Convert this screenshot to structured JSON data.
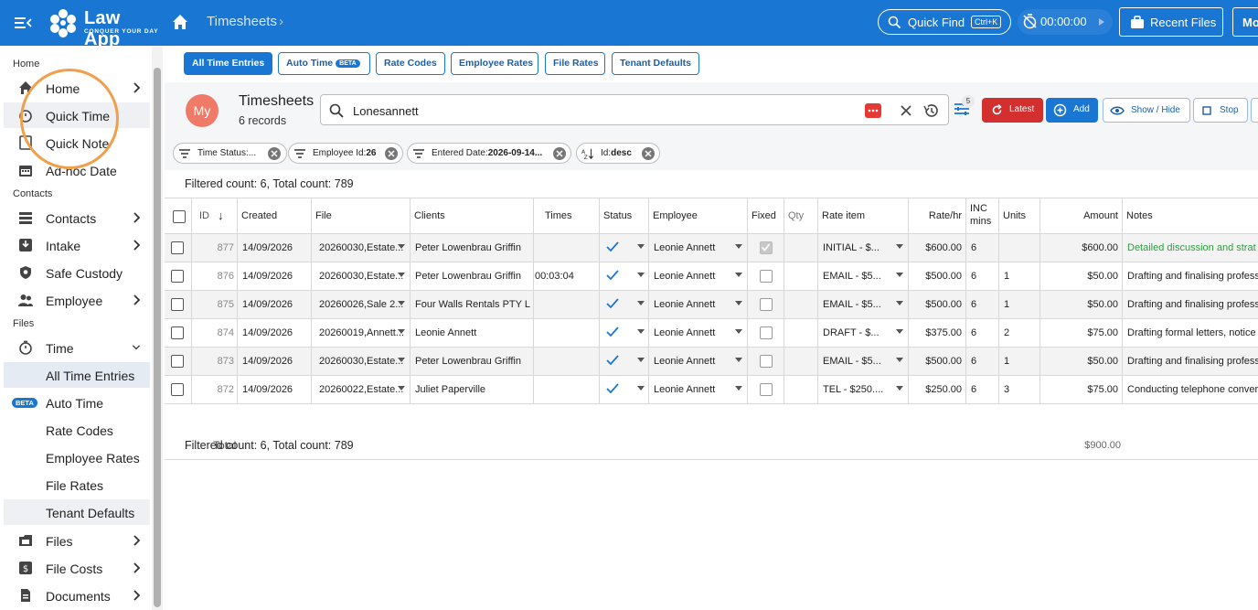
{
  "topbar": {
    "app_name": "Law App",
    "tagline": "CONQUER YOUR DAY",
    "breadcrumb": "Timesheets",
    "quick_find": "Quick Find",
    "quick_find_shortcut": "Ctrl+K",
    "timer": "00:00:00",
    "recent_files": "Recent Files",
    "more_label": "Mo"
  },
  "sidebar": {
    "sections": {
      "home": "Home",
      "contacts": "Contacts",
      "files": "Files"
    },
    "items": [
      {
        "label": "Home"
      },
      {
        "label": "Quick Time"
      },
      {
        "label": "Quick Note"
      },
      {
        "label": "Ad-hoc Date"
      },
      {
        "label": "Contacts"
      },
      {
        "label": "Intake"
      },
      {
        "label": "Safe Custody"
      },
      {
        "label": "Employee"
      },
      {
        "label": "Time"
      },
      {
        "label": "All Time Entries"
      },
      {
        "label": "Auto Time",
        "badge": "BETA"
      },
      {
        "label": "Rate Codes"
      },
      {
        "label": "Employee Rates"
      },
      {
        "label": "File Rates"
      },
      {
        "label": "Tenant Defaults"
      },
      {
        "label": "Files"
      },
      {
        "label": "File Costs"
      },
      {
        "label": "Documents"
      }
    ]
  },
  "tabs": [
    {
      "label": "All Time Entries"
    },
    {
      "label": "Auto Time",
      "badge": "BETA"
    },
    {
      "label": "Rate Codes"
    },
    {
      "label": "Employee Rates"
    },
    {
      "label": "File Rates"
    },
    {
      "label": "Tenant Defaults"
    }
  ],
  "header": {
    "avatar": "My",
    "title": "Timesheets",
    "records": "6 records",
    "search_value": "Lonesannett",
    "filter_count": "5",
    "latest": "Latest",
    "add": "Add",
    "show_hide": "Show / Hide",
    "stop": "Stop"
  },
  "chips": [
    {
      "label": "Time Status:..."
    },
    {
      "label": "Employee Id:",
      "value": "26"
    },
    {
      "label": "Entered Date:",
      "value": "2026-09-14..."
    },
    {
      "label": "Id:",
      "value": "desc"
    }
  ],
  "filtered_count": "Filtered count: 6, Total count: 789",
  "columns": [
    "ID",
    "Created",
    "File",
    "Clients",
    "Times",
    "Status",
    "Employee",
    "Fixed",
    "Qty",
    "Rate item",
    "Rate/hr",
    "INC mins",
    "Units",
    "Amount",
    "Notes"
  ],
  "rows": [
    {
      "id": "877",
      "created": "14/09/2026",
      "file": "20260030,Estate...",
      "client": "Peter Lowenbrau Griffin",
      "times": "",
      "employee": "Leonie Annett",
      "fixed": true,
      "rate_item": "INITIAL - $...",
      "rate": "$600.00",
      "inc": "6",
      "units": "",
      "amount": "$600.00",
      "notes": "Detailed discussion and strat",
      "notes_green": true
    },
    {
      "id": "876",
      "created": "14/09/2026",
      "file": "20260030,Estate...",
      "client": "Peter Lowenbrau Griffin",
      "times": "00:03:04",
      "employee": "Leonie Annett",
      "fixed": false,
      "rate_item": "EMAIL - $5...",
      "rate": "$500.00",
      "inc": "6",
      "units": "1",
      "amount": "$50.00",
      "notes": "Drafting and finalising profess",
      "notes_green": false
    },
    {
      "id": "875",
      "created": "14/09/2026",
      "file": "20260026,Sale 2...",
      "client": "Four Walls Rentals PTY L",
      "times": "",
      "employee": "Leonie Annett",
      "fixed": false,
      "rate_item": "EMAIL - $5...",
      "rate": "$500.00",
      "inc": "6",
      "units": "1",
      "amount": "$50.00",
      "notes": "Drafting and finalising profess",
      "notes_green": false
    },
    {
      "id": "874",
      "created": "14/09/2026",
      "file": "20260019,Annett...",
      "client": "Leonie Annett",
      "times": "",
      "employee": "Leonie Annett",
      "fixed": false,
      "rate_item": "DRAFT - $...",
      "rate": "$375.00",
      "inc": "6",
      "units": "2",
      "amount": "$75.00",
      "notes": "Drafting formal letters, notice",
      "notes_green": false
    },
    {
      "id": "873",
      "created": "14/09/2026",
      "file": "20260030,Estate...",
      "client": "Peter Lowenbrau Griffin",
      "times": "",
      "employee": "Leonie Annett",
      "fixed": false,
      "rate_item": "EMAIL - $5...",
      "rate": "$500.00",
      "inc": "6",
      "units": "1",
      "amount": "$50.00",
      "notes": "Drafting and finalising profess",
      "notes_green": false
    },
    {
      "id": "872",
      "created": "14/09/2026",
      "file": "20260022,Estate...",
      "client": "Juliet Paperville",
      "times": "",
      "employee": "Leonie Annett",
      "fixed": false,
      "rate_item": "TEL - $250....",
      "rate": "$250.00",
      "inc": "6",
      "units": "3",
      "amount": "$75.00",
      "notes": "Conducting telephone conver",
      "notes_green": false
    }
  ],
  "total": {
    "label": "Total",
    "amount": "$900.00"
  },
  "colors": {
    "primary": "#1976d2",
    "danger": "#d32f2f",
    "avatar": "#ef7a68",
    "highlight": "#f0a04b",
    "note_green": "#2e9e3f"
  }
}
